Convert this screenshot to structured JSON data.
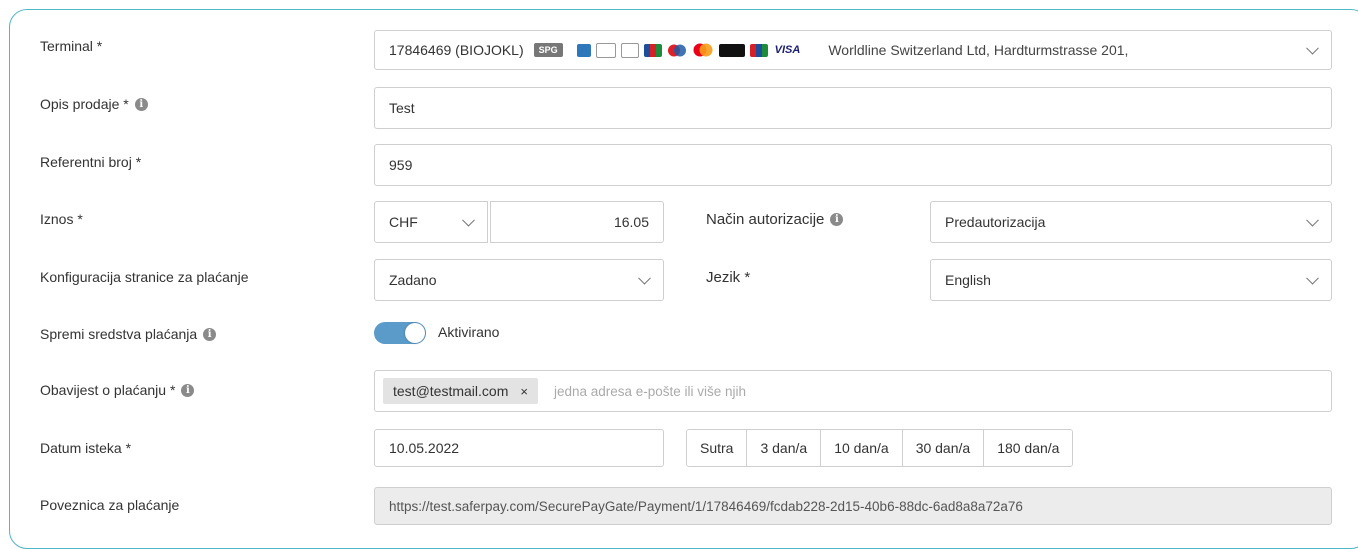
{
  "terminal": {
    "label": "Terminal *",
    "id": "17846469 (BIOJOKL)",
    "spg_badge": "SPG",
    "provider": "Worldline Switzerland Ltd, Hardturmstrasse 201,",
    "cards": [
      "amex-icon",
      "applepay-icon",
      "bank-card-icon",
      "jcb-icon",
      "diners-icon",
      "mastercard-icon",
      "twint-icon",
      "unionpay-icon",
      "visa-icon"
    ],
    "visa_text": "VISA"
  },
  "opis": {
    "label": "Opis prodaje *",
    "value": "Test"
  },
  "referentni": {
    "label": "Referentni broj *",
    "value": "959"
  },
  "iznos": {
    "label": "Iznos *",
    "currency": "CHF",
    "amount": "16.05"
  },
  "autorizacija": {
    "label": "Način autorizacije",
    "value": "Predautorizacija"
  },
  "konfiguracija": {
    "label": "Konfiguracija stranice za plaćanje",
    "value": "Zadano"
  },
  "jezik": {
    "label": "Jezik *",
    "value": "English"
  },
  "spremi": {
    "label": "Spremi sredstva plaćanja",
    "toggle_text": "Aktivirano",
    "on": true
  },
  "obavijest": {
    "label": "Obavijest o plaćanju *",
    "tag": "test@testmail.com",
    "tag_close": "×",
    "placeholder": "jedna adresa e-pošte ili više njih"
  },
  "datum": {
    "label": "Datum isteka *",
    "value": "10.05.2022",
    "buttons": [
      "Sutra",
      "3 dan/a",
      "10 dan/a",
      "30 dan/a",
      "180 dan/a"
    ]
  },
  "poveznica": {
    "label": "Poveznica za plaćanje",
    "value": "https://test.saferpay.com/SecurePayGate/Payment/1/17846469/fcdab228-2d15-40b6-88dc-6ad8a8a72a76"
  },
  "colors": {
    "accent": "#4fb8c8",
    "toggle": "#5b9bc9",
    "border": "#cfcfcf"
  }
}
